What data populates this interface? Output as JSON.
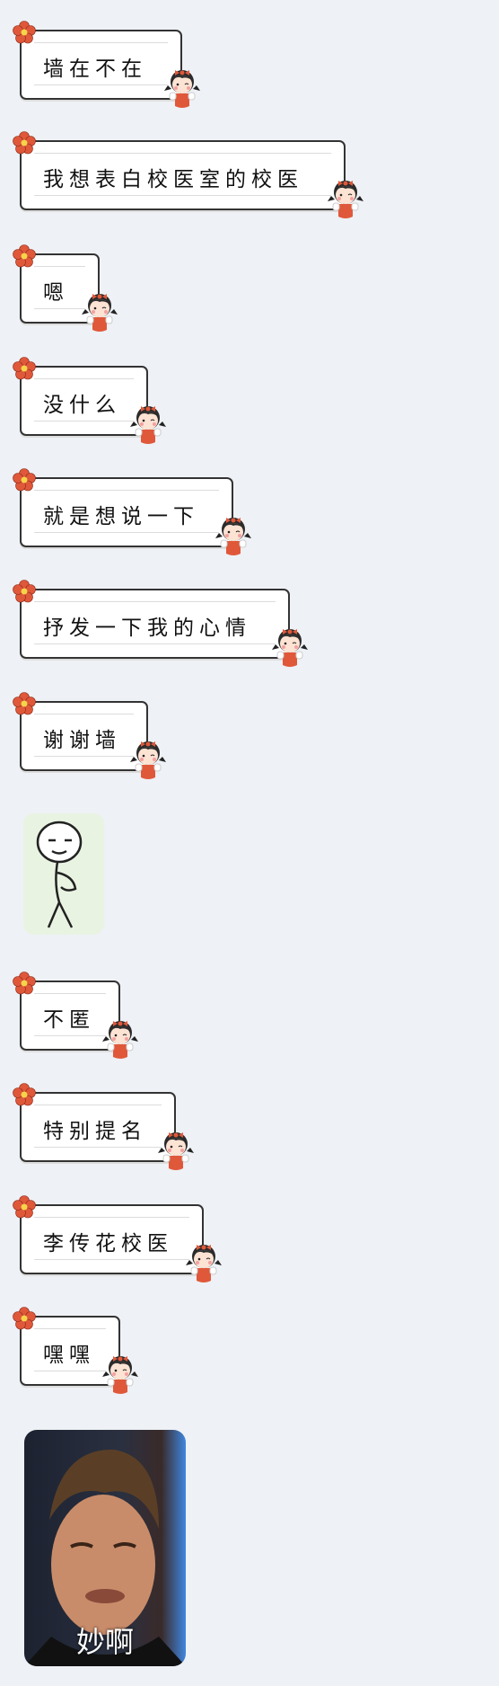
{
  "messages": [
    {
      "type": "text",
      "text": "墙在不在"
    },
    {
      "type": "text",
      "text": "我想表白校医室的校医"
    },
    {
      "type": "text",
      "text": "嗯"
    },
    {
      "type": "text",
      "text": "没什么"
    },
    {
      "type": "text",
      "text": "就是想说一下"
    },
    {
      "type": "text",
      "text": "抒发一下我的心情"
    },
    {
      "type": "text",
      "text": "谢谢墙"
    },
    {
      "type": "sticker",
      "icon": "stick-figure-sticker"
    },
    {
      "type": "text",
      "text": "不匿"
    },
    {
      "type": "text",
      "text": "特别提名"
    },
    {
      "type": "text",
      "text": "李传花校医"
    },
    {
      "type": "text",
      "text": "嘿嘿"
    },
    {
      "type": "image",
      "caption": "妙啊"
    }
  ],
  "colors": {
    "background": "#eef1f5",
    "bubble_border": "#333333",
    "flower": "#e0583a"
  }
}
